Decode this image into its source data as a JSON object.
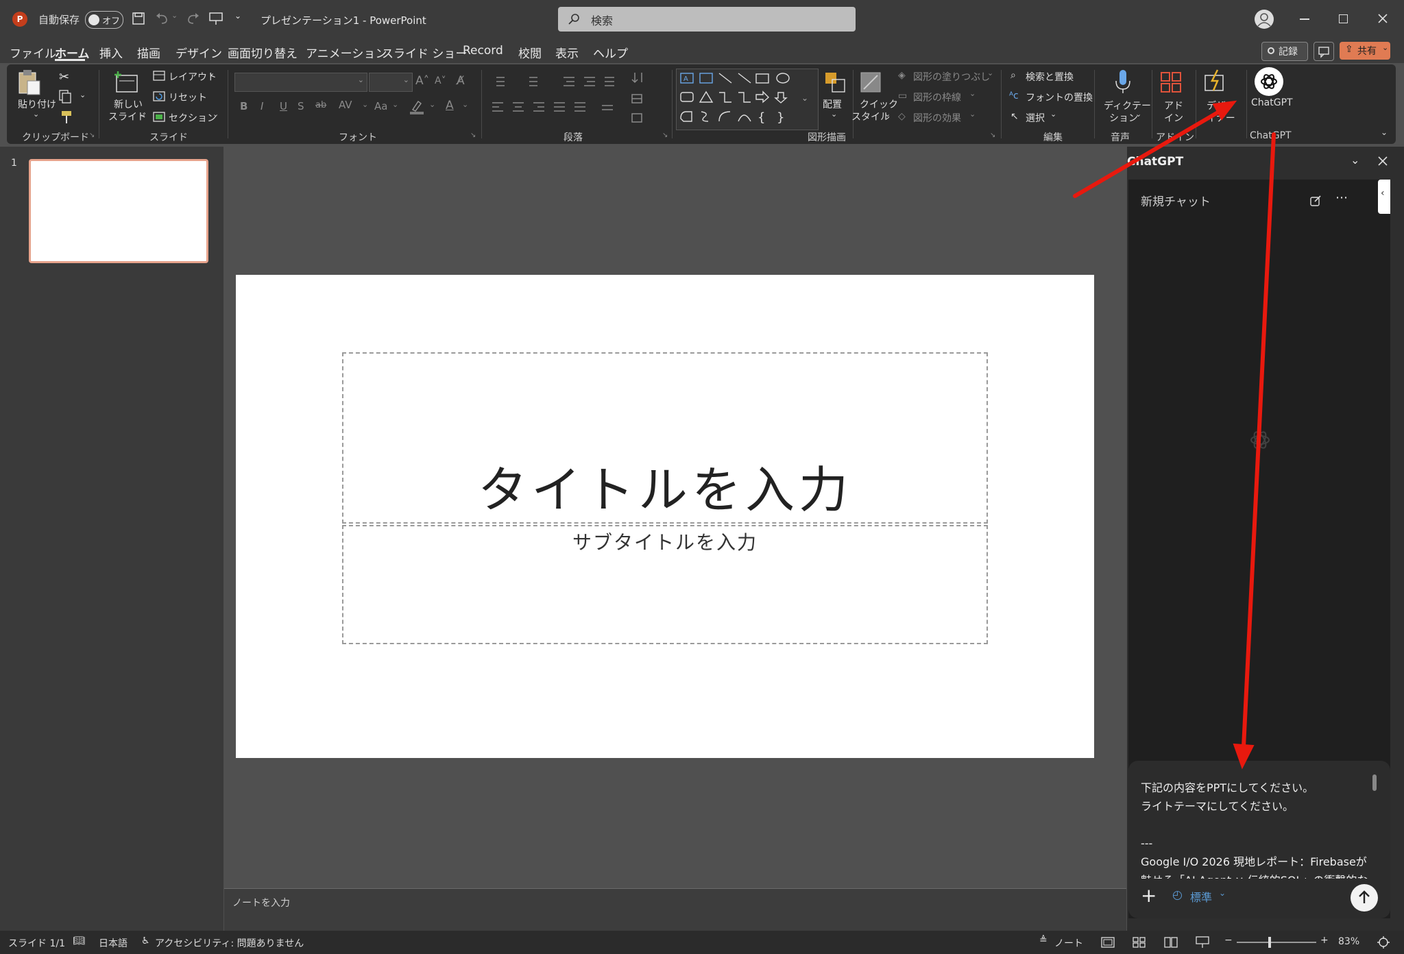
{
  "titlebar": {
    "autosave_label": "自動保存",
    "autosave_toggle": "オフ",
    "doc_title": "プレゼンテーション1  -  PowerPoint",
    "search_placeholder": "検索"
  },
  "menu": {
    "tabs": [
      "ファイル",
      "ホーム",
      "挿入",
      "描画",
      "デザイン",
      "画面切り替え",
      "アニメーション",
      "スライド ショー",
      "Record",
      "校閲",
      "表示",
      "ヘルプ"
    ],
    "active": "ホーム",
    "record_button": "記録",
    "share_button": "共有"
  },
  "ribbon": {
    "clipboard": {
      "paste": "貼り付け",
      "label": "クリップボード"
    },
    "slides": {
      "new_slide_1": "新しい",
      "new_slide_2": "スライド",
      "layout": "レイアウト",
      "reset": "リセット",
      "section": "セクション",
      "label": "スライド"
    },
    "font": {
      "label": "フォント",
      "bold": "B",
      "italic": "I",
      "underline": "U",
      "shadow": "S",
      "strike": "ab",
      "spacing": "AV",
      "case": "Aa"
    },
    "paragraph": {
      "label": "段落"
    },
    "drawing": {
      "arrange": "配置",
      "quick_style_1": "クイック",
      "quick_style_2": "スタイル",
      "fill": "図形の塗りつぶし",
      "outline": "図形の枠線",
      "effects": "図形の効果",
      "label": "図形描画"
    },
    "editing": {
      "find_replace": "検索と置換",
      "font_replace": "フォントの置換",
      "select": "選択",
      "label": "編集"
    },
    "voice": {
      "dictate_1": "ディクテー",
      "dictate_2": "ション",
      "label": "音声"
    },
    "addins": {
      "addin_1": "アド",
      "addin_2": "イン",
      "label": "アドイン"
    },
    "designer": {
      "label_1": "デザ",
      "label_2": "イナー"
    },
    "chatgpt": {
      "button": "ChatGPT",
      "label": "ChatGPT"
    }
  },
  "thumbnails": {
    "number": "1"
  },
  "slide": {
    "title_placeholder": "タイトルを入力",
    "subtitle_placeholder": "サブタイトルを入力"
  },
  "notes": {
    "placeholder": "ノートを入力"
  },
  "chat": {
    "pane_title": "ChatGPT",
    "header": "新規チャット",
    "message_lines": [
      "下記の内容をPPTにしてください。",
      "ライトテーマにしてください。",
      "",
      "---",
      "Google I/O 2026 現地レポート：Firebaseが",
      "魅せる「AI Agent × 伝統的SQL」の衝撃的な"
    ],
    "model": "標準"
  },
  "statusbar": {
    "slide_count": "スライド 1/1",
    "language": "日本語",
    "accessibility": "アクセシビリティ: 問題ありません",
    "notes": "ノート",
    "zoom": "83%"
  },
  "colors": {
    "accent": "#c43e1c",
    "annotation": "#e8190e"
  }
}
